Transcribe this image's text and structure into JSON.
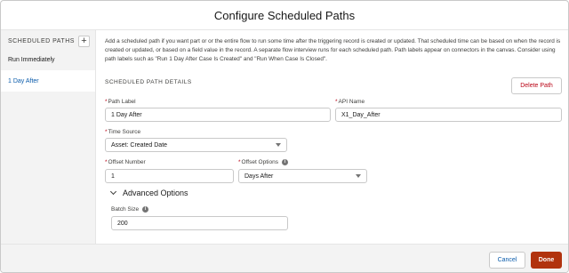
{
  "modal": {
    "title": "Configure Scheduled Paths"
  },
  "sidebar": {
    "title": "SCHEDULED PATHS",
    "add_label": "+",
    "items": [
      {
        "label": "Run Immediately"
      },
      {
        "label": "1 Day After"
      }
    ]
  },
  "main": {
    "description": "Add a scheduled path if you want part or or the entire flow to run some time after the triggering record is created or updated. That scheduled time can be based on when the record is created or updated, or based on a field value in the record. A separate flow interview runs for each scheduled path. Path labels appear on connectors in the canvas. Consider using path labels such as \"Run 1 Day After Case Is Created\" and \"Run When Case Is Closed\".",
    "section_title": "SCHEDULED PATH DETAILS",
    "delete_label": "Delete Path",
    "required_mark": "*",
    "info_glyph": "i",
    "path_label": {
      "label": "Path Label",
      "value": "1 Day After"
    },
    "api_name": {
      "label": "API Name",
      "value": "X1_Day_After"
    },
    "time_source": {
      "label": "Time Source",
      "value": "Asset: Created Date"
    },
    "offset_number": {
      "label": "Offset Number",
      "value": "1"
    },
    "offset_options": {
      "label": "Offset Options",
      "value": "Days After"
    },
    "advanced": {
      "label": "Advanced Options",
      "expanded": true
    },
    "batch_size": {
      "label": "Batch Size",
      "value": "200"
    }
  },
  "footer": {
    "cancel_label": "Cancel",
    "done_label": "Done"
  },
  "colors": {
    "brand_blue": "#0b5cab",
    "done_orange": "#b1330e",
    "delete_red": "#ba0517"
  }
}
